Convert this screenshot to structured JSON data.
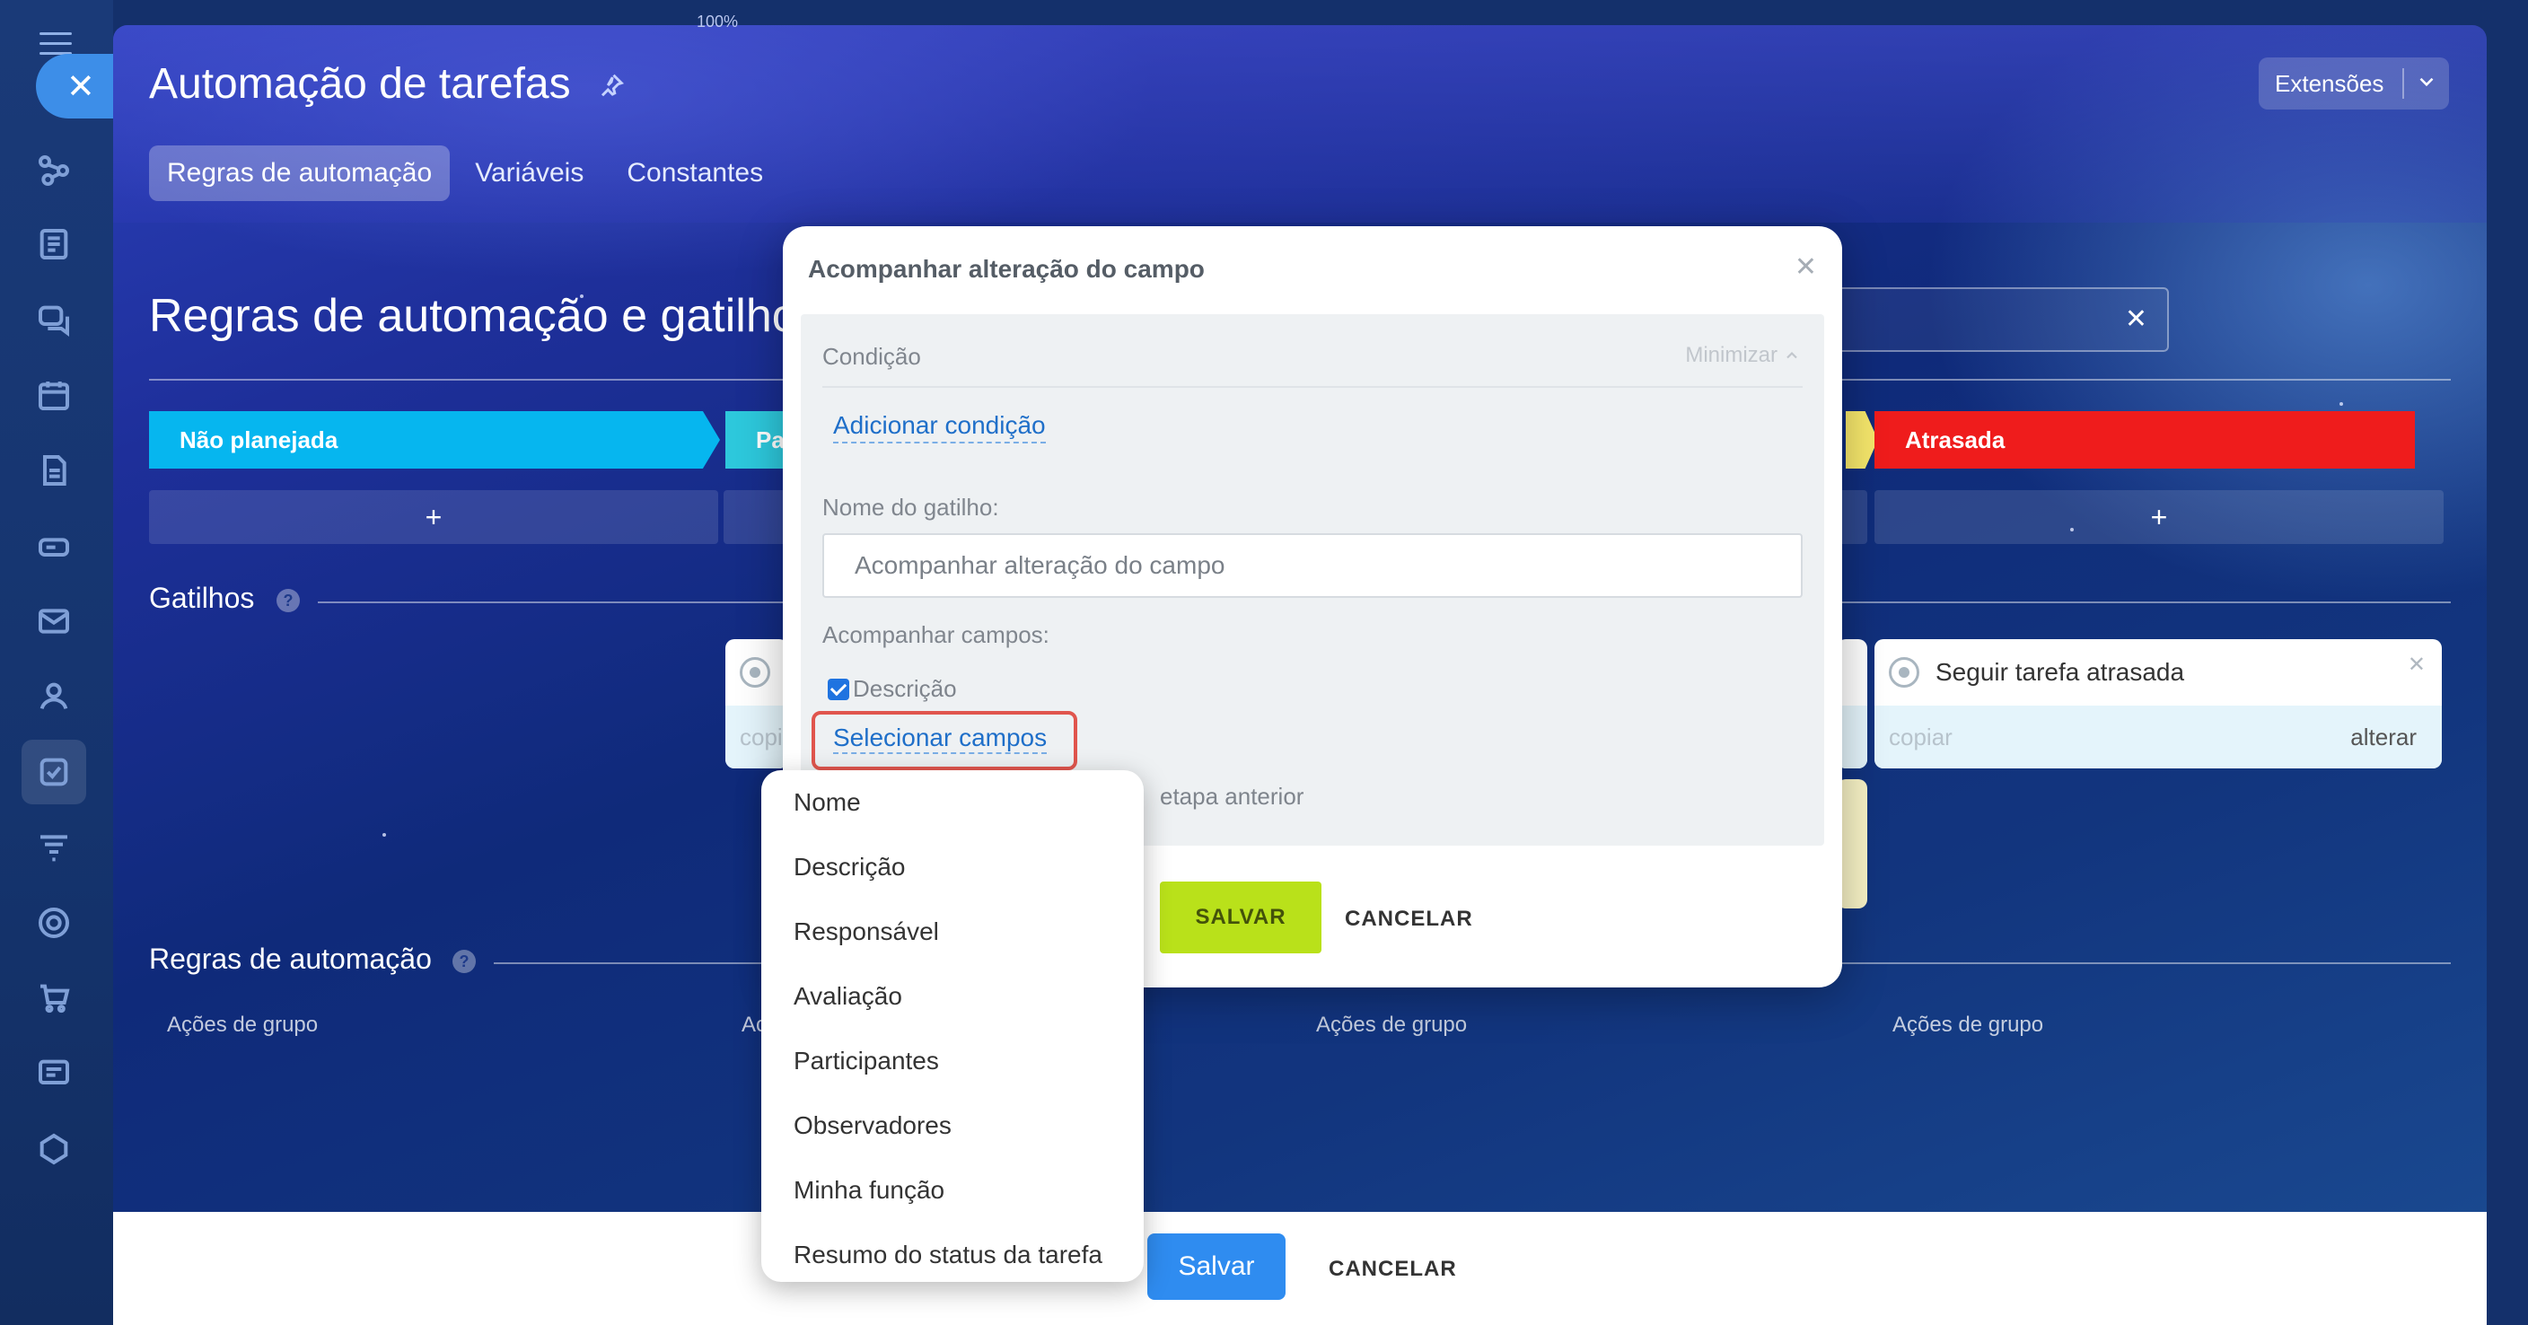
{
  "top_zoom": "100%",
  "header": {
    "title": "Automação de tarefas",
    "extensions_label": "Extensões",
    "tabs": [
      {
        "label": "Regras de automação",
        "active": true
      },
      {
        "label": "Variáveis",
        "active": false
      },
      {
        "label": "Constantes",
        "active": false
      }
    ]
  },
  "main": {
    "section_title": "Regras de automação e gatilhos",
    "stages": [
      {
        "label": "Não planejada",
        "color": "#06b6ef"
      },
      {
        "label": "Pa",
        "color": "#2dc8dc"
      },
      {
        "label": "Atrasada",
        "color": "#ef1c1c"
      }
    ],
    "add_symbol": "+",
    "triggers_title": "Gatilhos",
    "help_symbol": "?",
    "trigger_card_left": {
      "copy": "copia"
    },
    "trigger_card_right": {
      "title": "Seguir tarefa atrasada",
      "copy": "copiar",
      "alter": "alterar"
    },
    "rules_title": "Regras de automação",
    "group_actions": [
      "Ações de grupo",
      "Ac",
      "Ações de grupo",
      "Ações de grupo"
    ]
  },
  "footer": {
    "save_label": "Salvar",
    "cancel_label": "CANCELAR"
  },
  "modal": {
    "title": "Acompanhar alteração do campo",
    "condition_label": "Condição",
    "minimize_label": "Minimizar",
    "add_condition": "Adicionar condição",
    "trigger_name_label": "Nome do gatilho:",
    "trigger_name_value": "Acompanhar alteração do campo",
    "track_fields_label": "Acompanhar campos:",
    "checked_field": "Descrição",
    "select_fields": "Selecionar campos",
    "prev_stage_text": "etapa anterior",
    "save_label": "SALVAR",
    "cancel_label": "CANCELAR"
  },
  "dropdown": {
    "options": [
      "Nome",
      "Descrição",
      "Responsável",
      "Avaliação",
      "Participantes",
      "Observadores",
      "Minha função",
      "Resumo do status da tarefa"
    ]
  },
  "colors": {
    "accent_blue": "#2f8cf0",
    "link_blue": "#1f6fc9",
    "modal_save_green": "#b9e11a",
    "highlight_red": "#e0554d"
  }
}
